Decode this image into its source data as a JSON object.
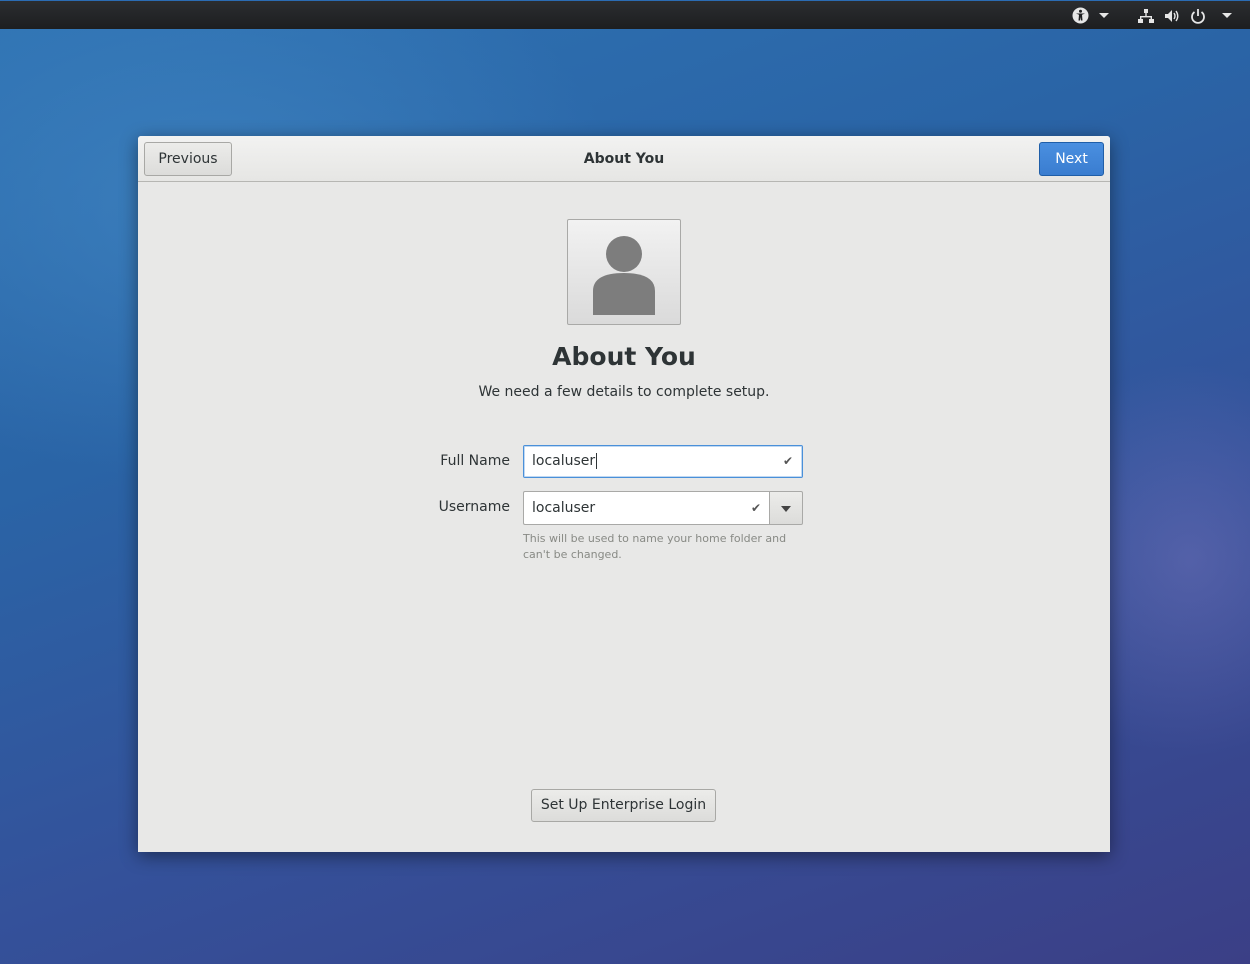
{
  "topbar": {
    "accessibility_icon": "accessibility-icon",
    "network_icon": "network-icon",
    "volume_icon": "volume-icon",
    "power_icon": "power-icon"
  },
  "dialog": {
    "header_title": "About You",
    "previous_label": "Previous",
    "next_label": "Next",
    "avatar_icon": "user-avatar-icon",
    "title": "About You",
    "subtitle": "We need a few details to complete setup.",
    "full_name": {
      "label": "Full Name",
      "value": "localuser",
      "status_icon": "check-icon"
    },
    "username": {
      "label": "Username",
      "value": "localuser",
      "status_icon": "check-icon",
      "hint": "This will be used to name your home folder and can't be changed."
    },
    "enterprise_label": "Set Up Enterprise Login"
  },
  "colors": {
    "accent": "#3a7dd0",
    "focus_border": "#4a90d9",
    "dialog_bg": "#e8e8e7",
    "topbar_bg": "#1d1e20"
  }
}
